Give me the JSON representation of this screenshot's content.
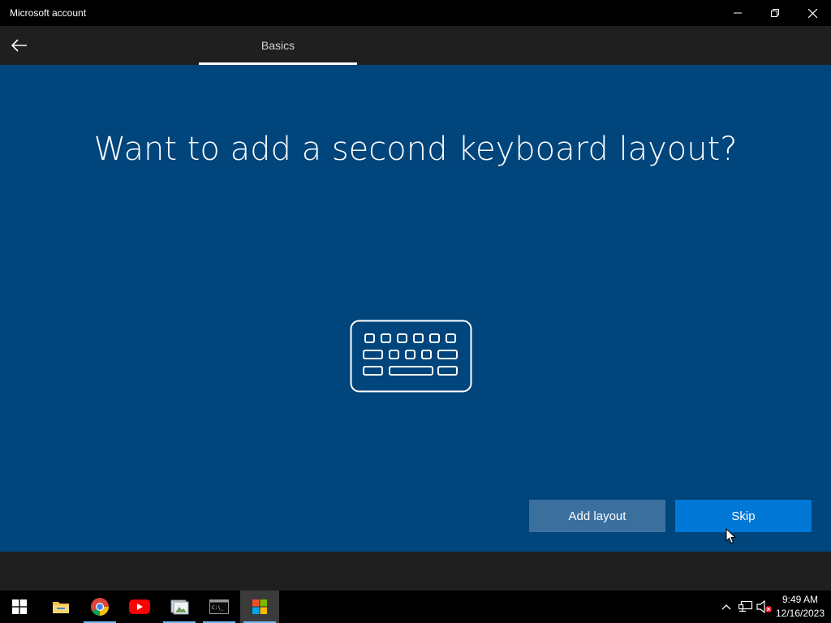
{
  "window": {
    "title": "Microsoft account",
    "controls": [
      "minimize-icon",
      "restore-icon",
      "close-icon"
    ]
  },
  "header": {
    "back_icon": "back-arrow-icon",
    "tab_label": "Basics"
  },
  "main": {
    "heading": "Want to add a second keyboard layout?",
    "illustration_icon": "keyboard-icon",
    "add_layout_label": "Add layout",
    "skip_label": "Skip"
  },
  "colors": {
    "background": "#00457c",
    "header": "#1f1f1f",
    "skip_button": "#0078d7",
    "add_button": "#3b6f9e"
  },
  "taskbar": {
    "items": [
      {
        "name": "start-icon"
      },
      {
        "name": "file-explorer-icon"
      },
      {
        "name": "chrome-icon"
      },
      {
        "name": "youtube-icon"
      },
      {
        "name": "photos-icon"
      },
      {
        "name": "terminal-icon"
      },
      {
        "name": "microsoft-store-icon"
      }
    ],
    "tray": [
      "chevron-up-icon",
      "network-icon",
      "volume-muted-icon"
    ],
    "clock": {
      "time": "9:49 AM",
      "date": "12/16/2023"
    }
  }
}
